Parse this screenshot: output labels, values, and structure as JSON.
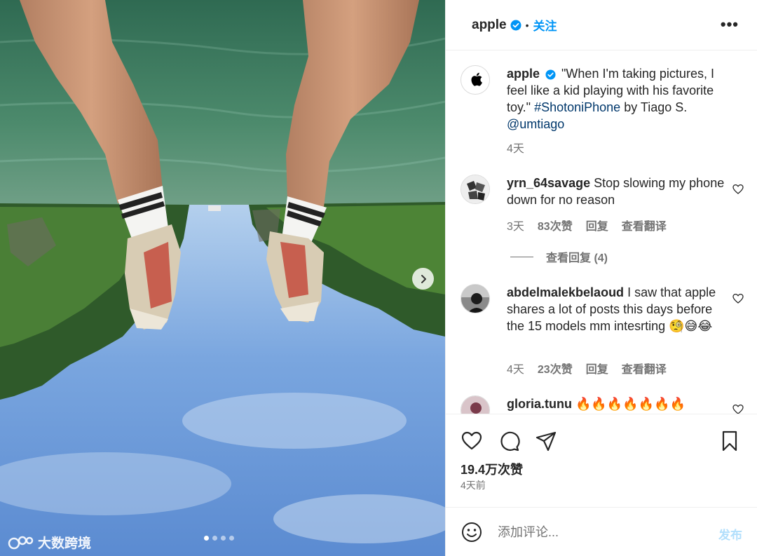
{
  "post": {
    "author": "apple",
    "follow_label": "关注",
    "dot_separator": "•",
    "more_label": "•••",
    "carousel": {
      "total_slides": 4,
      "active_slide": 1
    },
    "watermark": "大数跨境"
  },
  "caption": {
    "username": "apple",
    "text_part1": "\"When I'm taking pictures, I feel like a kid playing with his favorite toy.\" ",
    "hashtag": "#ShotoniPhone",
    "text_part2": " by Tiago S. ",
    "mention": "@umtiago",
    "time": "4天"
  },
  "comments": [
    {
      "username": "yrn_64savage",
      "text": "Stop slowing my phone down for no reason",
      "time": "3天",
      "likes": "83次赞",
      "reply_label": "回复",
      "translate_label": "查看翻译",
      "view_replies": "查看回复 (4)"
    },
    {
      "username": "abdelmalekbelaoud",
      "text": "I saw that apple shares a lot of posts this days before the 15 models mm intesrting 🧐😅😂",
      "time": "4天",
      "likes": "23次赞",
      "reply_label": "回复",
      "translate_label": "查看翻译"
    },
    {
      "username": "gloria.tunu",
      "text": "🔥🔥🔥🔥🔥🔥🔥"
    }
  ],
  "footer": {
    "likes_count": "19.4万次赞",
    "posted_time": "4天前",
    "comment_placeholder": "添加评论...",
    "post_label": "发布"
  },
  "colors": {
    "link": "#00376b",
    "accent": "#0095f6",
    "post_disabled": "#b2dffc",
    "muted": "#737373"
  }
}
